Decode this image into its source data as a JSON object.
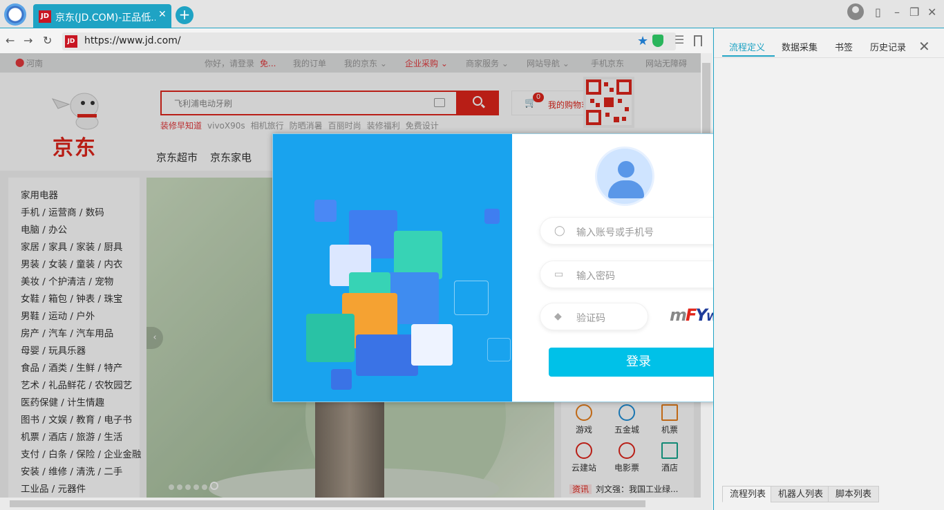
{
  "browser": {
    "tab_title": "京东(JD.COM)-正品低...",
    "tab_favicon": "JD",
    "url": "https://www.jd.com/",
    "accent": "#1fa3c4"
  },
  "jd": {
    "topbar": {
      "location": "河南",
      "greeting": "你好，请登录",
      "register": "免...",
      "links": [
        "我的订单",
        "我的京东 ⌄",
        "企业采购 ⌄",
        "商家服务 ⌄",
        "网站导航 ⌄",
        "手机京东",
        "网站无障碍"
      ]
    },
    "logo_text": "京东",
    "search_placeholder": "飞利浦电动牙刷",
    "hotwords": [
      "装修早知道",
      "vivoX90s",
      "相机旅行",
      "防晒消暑",
      "百丽时尚",
      "装修福利",
      "免费设计"
    ],
    "cart_label": "我的购物车",
    "cart_count": "0",
    "nav": [
      "京东超市",
      "京东家电"
    ],
    "categories": [
      "家用电器",
      "手机 / 运营商 / 数码",
      "电脑 / 办公",
      "家居 / 家具 / 家装 / 厨具",
      "男装 / 女装 / 童装 / 内衣",
      "美妆 / 个护清洁 / 宠物",
      "女鞋 / 箱包 / 钟表 / 珠宝",
      "男鞋 / 运动 / 户外",
      "房产 / 汽车 / 汽车用品",
      "母婴 / 玩具乐器",
      "食品 / 酒类 / 生鲜 / 特产",
      "艺术 / 礼品鲜花 / 农牧园艺",
      "医药保健 / 计生情趣",
      "图书 / 文娱 / 教育 / 电子书",
      "机票 / 酒店 / 旅游 / 生活",
      "支付 / 白条 / 保险 / 企业金融",
      "安装 / 维修 / 清洗 / 二手",
      "工业品 / 元器件"
    ],
    "services": [
      "游戏",
      "五金城",
      "机票",
      "云建站",
      "电影票",
      "酒店"
    ],
    "news_tag": "资讯",
    "news_text": "刘文强：我国工业绿..."
  },
  "login": {
    "account_placeholder": "输入账号或手机号",
    "password_placeholder": "输入密码",
    "captcha_placeholder": "验证码",
    "captcha_text": "mFYW",
    "login_label": "登录"
  },
  "side": {
    "tabs": [
      "流程定义",
      "数据采集",
      "书签",
      "历史记录"
    ],
    "bottom_tabs": [
      "流程列表",
      "机器人列表",
      "脚本列表"
    ]
  }
}
